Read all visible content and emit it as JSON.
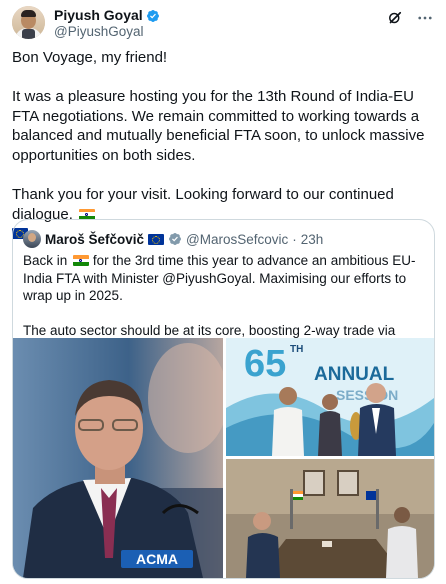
{
  "author": {
    "display_name": "Piyush Goyal",
    "handle": "@PiyushGoyal"
  },
  "icons": {
    "verified": "verified-badge-icon",
    "grok": "grok-icon",
    "more": "more-icon",
    "flag_india": "india-flag-icon",
    "flag_eu": "eu-flag-icon"
  },
  "colors": {
    "verified": "#1d9bf0",
    "secondary_text": "#536471",
    "border": "#cfd9de"
  },
  "tweet": {
    "line1": "Bon Voyage, my friend!",
    "para2": "It was a pleasure hosting you for the 13th Round of India-EU FTA negotiations. We remain committed to working towards a balanced and mutually beneficial FTA soon, to unlock massive opportunities on both sides.",
    "para3": "Thank you for your visit. Looking forward to our continued dialogue."
  },
  "quoted": {
    "display_name": "Maroš Šefčovič",
    "handle": "@MarosSefcovic",
    "separator": "·",
    "time": "23h",
    "text1_a": "Back in",
    "text1_b": "for the 3rd time this year to advance an ambitious EU-India FTA with Minister @PiyushGoyal. Maximising our efforts to wrap up in 2025.",
    "text2": "The auto sector should be at its core, boosting 2-way trade via win-win tariff liberalisation....",
    "images": {
      "left_sign": "ACMA",
      "top_right_banner_num": "65",
      "top_right_banner_suffix": "TH",
      "top_right_banner_word": "ANNUAL",
      "top_right_banner_word2": "SESSION"
    }
  }
}
